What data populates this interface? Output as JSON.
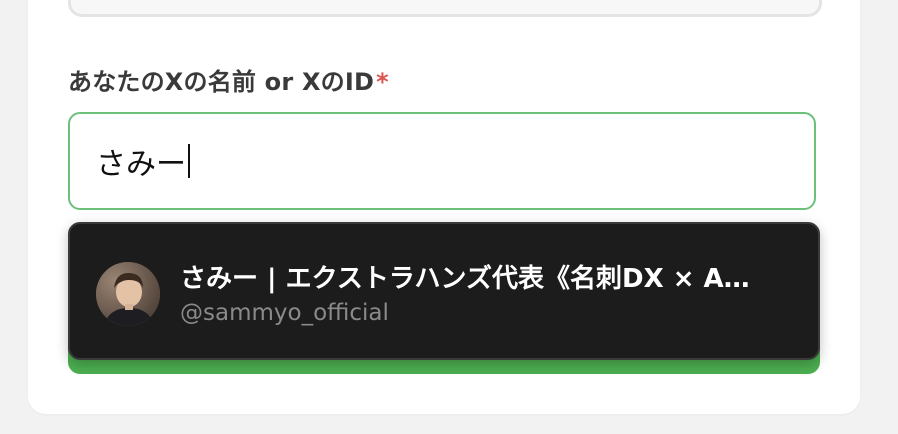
{
  "form": {
    "field_label": "あなたのXの名前 or XのID",
    "required_mark": "*",
    "input_value": "さみー"
  },
  "suggestion": {
    "display_name": "さみー | エクストラハンズ代表《名刺DX × A…",
    "handle": "@sammyo_official",
    "avatar_icon": "user-avatar-photo"
  },
  "colors": {
    "input_border_focus": "#6cc07a",
    "required": "#d9534f",
    "popup_bg": "#1c1c1c",
    "accent_green": "#4caf50"
  }
}
